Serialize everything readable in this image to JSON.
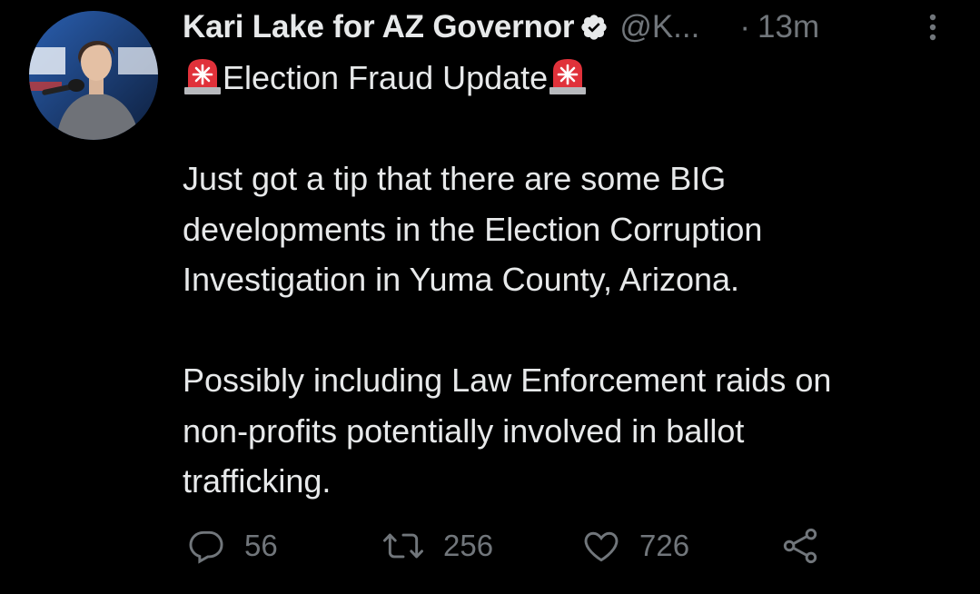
{
  "tweet": {
    "author_name": "Kari Lake for AZ Governor",
    "handle": "@K...",
    "separator": "·",
    "time": "13m",
    "headline": "Election Fraud Update",
    "paragraph1": [
      "Just got a tip that there are some BIG",
      "developments in the Election Corruption",
      "Investigation in Yuma County, Arizona."
    ],
    "paragraph2": [
      "Possibly including Law Enforcement raids on",
      "non-profits potentially involved in ballot",
      "trafficking."
    ]
  },
  "actions": {
    "replies": "56",
    "retweets": "256",
    "likes": "726"
  },
  "icons": {
    "verified": "verified-badge-icon",
    "more": "more-options-icon",
    "siren": "siren-emoji-icon",
    "reply": "reply-icon",
    "retweet": "retweet-icon",
    "like": "heart-icon",
    "share": "share-icon"
  },
  "colors": {
    "background": "#000000",
    "text": "#e7e9ea",
    "secondary": "#71767b",
    "siren_red": "#e0313a"
  }
}
